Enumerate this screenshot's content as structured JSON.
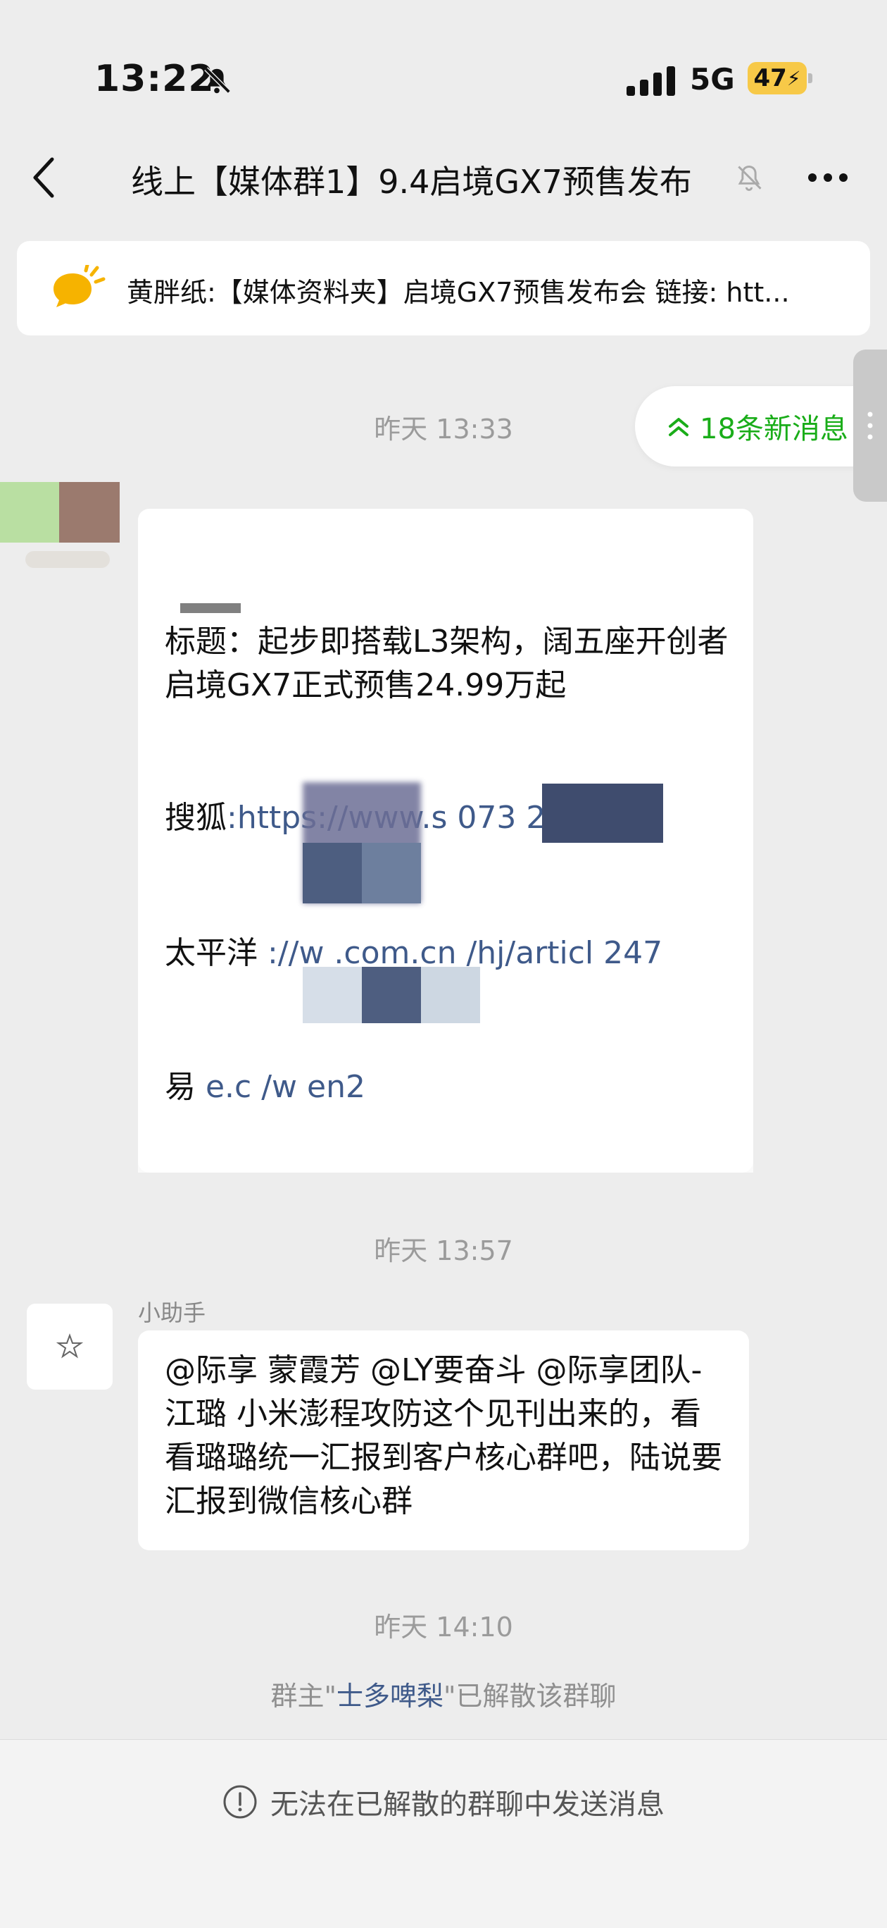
{
  "status_bar": {
    "time": "13:22",
    "network": "5G",
    "battery": "47"
  },
  "nav": {
    "title": "线上【媒体群1】9.4启境GX7预售发布",
    "icons": [
      "back-chevron-icon",
      "muted-bell-icon",
      "more-dots-icon"
    ]
  },
  "pinned_notice": {
    "text": "黄胖纸:【媒体资料夹】启境GX7预售发布会 链接: htt..."
  },
  "new_messages": {
    "label": "18条新消息"
  },
  "messages": [
    {
      "time": "昨天 13:33",
      "title": "标题：起步即搭载L3架构，阔五座开创者启境GX7正式预售24.99万起",
      "links": [
        {
          "source": "搜狐",
          "url_visible": ":https://www.s          073 283"
        },
        {
          "source": "太平洋",
          "url_visible": " ://w               .com.cn /hj/articl      247"
        },
        {
          "source": "易",
          "url_visible": "                 e.c        /w en2"
        }
      ]
    },
    {
      "time": "昨天 13:57",
      "sender": "小助手",
      "text": "@际享 蒙霞芳 @LY要奋斗 @际享团队-江璐 小米澎程攻防这个见刊出来的，看看璐璐统一汇报到客户核心群吧，陆说要汇报到微信核心群"
    }
  ],
  "system": {
    "time": "昨天 14:10",
    "prefix": "群主\"",
    "owner": "士多啤梨",
    "suffix": "\"已解散该群聊"
  },
  "bottom": {
    "notice": "无法在已解散的群聊中发送消息"
  },
  "colors": {
    "background": "#ededed",
    "bubble": "#ffffff",
    "accent_green": "#1aad19",
    "link_blue": "#3f5a8a",
    "battery_yellow": "#f7c948"
  }
}
